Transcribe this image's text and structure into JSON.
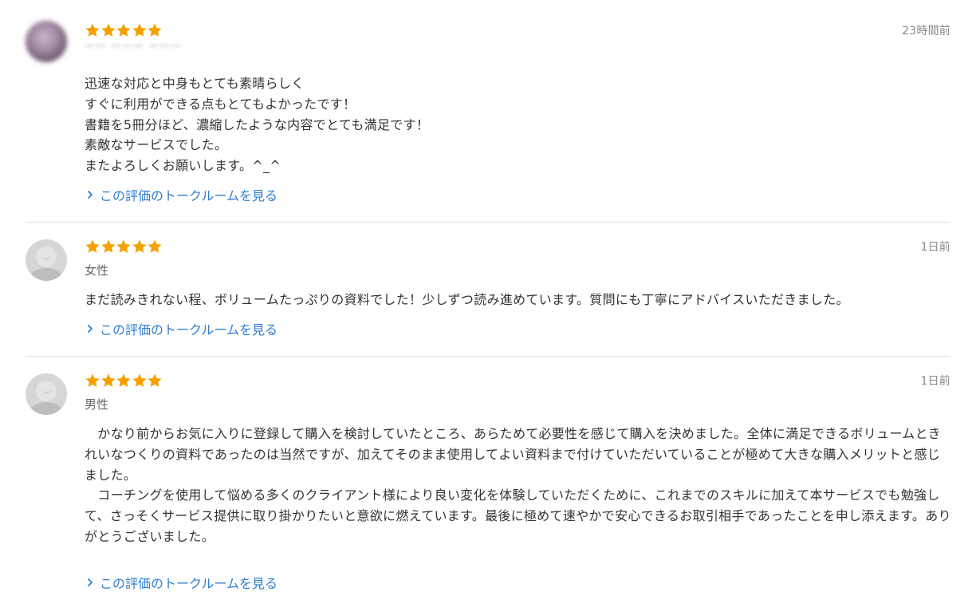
{
  "reviews": [
    {
      "rating": 5,
      "date": "23時間前",
      "reviewer": "—— ——— ———",
      "body": "迅速な対応と中身もとても素晴らしく\nすぐに利用ができる点もとてもよかったです！\n書籍を5冊分ほど、濃縮したような内容でとても満足です！\n素敵なサービスでした。\nまたよろしくお願いします。^_^",
      "link": "この評価のトークルームを見る"
    },
    {
      "rating": 5,
      "date": "1日前",
      "reviewer": "女性",
      "body": "まだ読みきれない程、ボリュームたっぷりの資料でした！少しずつ読み進めています。質問にも丁寧にアドバイスいただきました。",
      "link": "この評価のトークルームを見る"
    },
    {
      "rating": 5,
      "date": "1日前",
      "reviewer": "男性",
      "body": "　かなり前からお気に入りに登録して購入を検討していたところ、あらためて必要性を感じて購入を決めました。全体に満足できるボリュームときれいなつくりの資料であったのは当然ですが、加えてそのまま使用してよい資料まで付けていただいていることが極めて大きな購入メリットと感じました。\n　コーチングを使用して悩める多くのクライアント様により良い変化を体験していただくために、これまでのスキルに加えて本サービスでも勉強して、さっそくサービス提供に取り掛かりたいと意欲に燃えています。最後に極めて速やかで安心できるお取引相手であったことを申し添えます。ありがとうございました。",
      "link": "この評価のトークルームを見る"
    }
  ],
  "colors": {
    "star": "#f5a100",
    "link": "#2f7fd1",
    "date": "#888888",
    "divider": "#e2e2e2"
  },
  "icons": {
    "star": "star-icon",
    "chevron": "chevron-right-icon",
    "avatar_default": "default-user-avatar"
  }
}
